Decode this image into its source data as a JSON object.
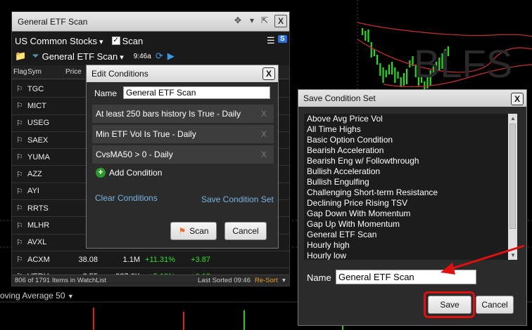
{
  "background": {
    "ticker_watermark": "BLFS",
    "indicator_label": "oving Average 50"
  },
  "scan_panel": {
    "title": "General ETF Scan",
    "watchlist": "US Common Stocks",
    "scan_checkbox": "Scan",
    "scan_name": "General ETF Scan",
    "time": "9:46a",
    "s_badge": "S",
    "columns": [
      "Flag",
      "Sym",
      "Price"
    ],
    "rows": [
      {
        "sym": "TGC",
        "price": "",
        "vol": "",
        "pct": "",
        "chg": ""
      },
      {
        "sym": "MICT",
        "price": "",
        "vol": "",
        "pct": "",
        "chg": ""
      },
      {
        "sym": "USEG",
        "price": "",
        "vol": "",
        "pct": "",
        "chg": ""
      },
      {
        "sym": "SAEX",
        "price": "",
        "vol": "",
        "pct": "",
        "chg": ""
      },
      {
        "sym": "YUMA",
        "price": "",
        "vol": "",
        "pct": "",
        "chg": ""
      },
      {
        "sym": "AZZ",
        "price": "5",
        "vol": "",
        "pct": "",
        "chg": ""
      },
      {
        "sym": "AYI",
        "price": "13",
        "vol": "",
        "pct": "",
        "chg": ""
      },
      {
        "sym": "RRTS",
        "price": "",
        "vol": "",
        "pct": "",
        "chg": ""
      },
      {
        "sym": "MLHR",
        "price": "3",
        "vol": "",
        "pct": "",
        "chg": ""
      },
      {
        "sym": "AVXL",
        "price": "",
        "vol": "",
        "pct": "",
        "chg": ""
      },
      {
        "sym": "ACXM",
        "price": "38.08",
        "vol": "1.1M",
        "pct": "+11.31%",
        "chg": "+3.87"
      },
      {
        "sym": "VERU",
        "price": "2.55",
        "vol": "387.6K",
        "pct": "+5.12%",
        "chg": "+0.12"
      }
    ],
    "status_count": "806 of 1791 Items in WatchList",
    "status_sorted": "Last Sorted 09:46",
    "status_resort": "Re-Sort"
  },
  "edit_dialog": {
    "title": "Edit Conditions",
    "name_label": "Name",
    "name_value": "General ETF Scan",
    "conditions": [
      "At least 250 bars history Is True - Daily",
      "Min ETF Vol Is True - Daily",
      "CvsMA50 > 0 - Daily"
    ],
    "remove_glyph": "X",
    "add_condition": "Add Condition",
    "clear_conditions": "Clear Conditions",
    "save_condition_set": "Save Condition Set",
    "scan_button": "Scan",
    "cancel_button": "Cancel",
    "close": "X"
  },
  "save_dialog": {
    "title": "Save Condition Set",
    "close": "X",
    "items": [
      "Above Avg Price Vol",
      "All Time Highs",
      "Basic Option Condition",
      "Bearish Acceleration",
      "Bearish Eng w/ Followthrough",
      "Bullish Acceleration",
      "Bullish Engulfing",
      "Challenging Short-term Resistance",
      "Declining Price Rising TSV",
      "Gap Down With Momentum",
      "Gap Up With Momentum",
      "General ETF Scan",
      "Hourly high",
      "Hourly low"
    ],
    "name_label": "Name",
    "name_value": "General ETF Scan",
    "save_button": "Save",
    "cancel_button": "Cancel"
  },
  "colors": {
    "highlight_red": "#e01010",
    "positive_green": "#28e028",
    "link_blue": "#7ab4e0",
    "candle_green": "#22dd22"
  }
}
